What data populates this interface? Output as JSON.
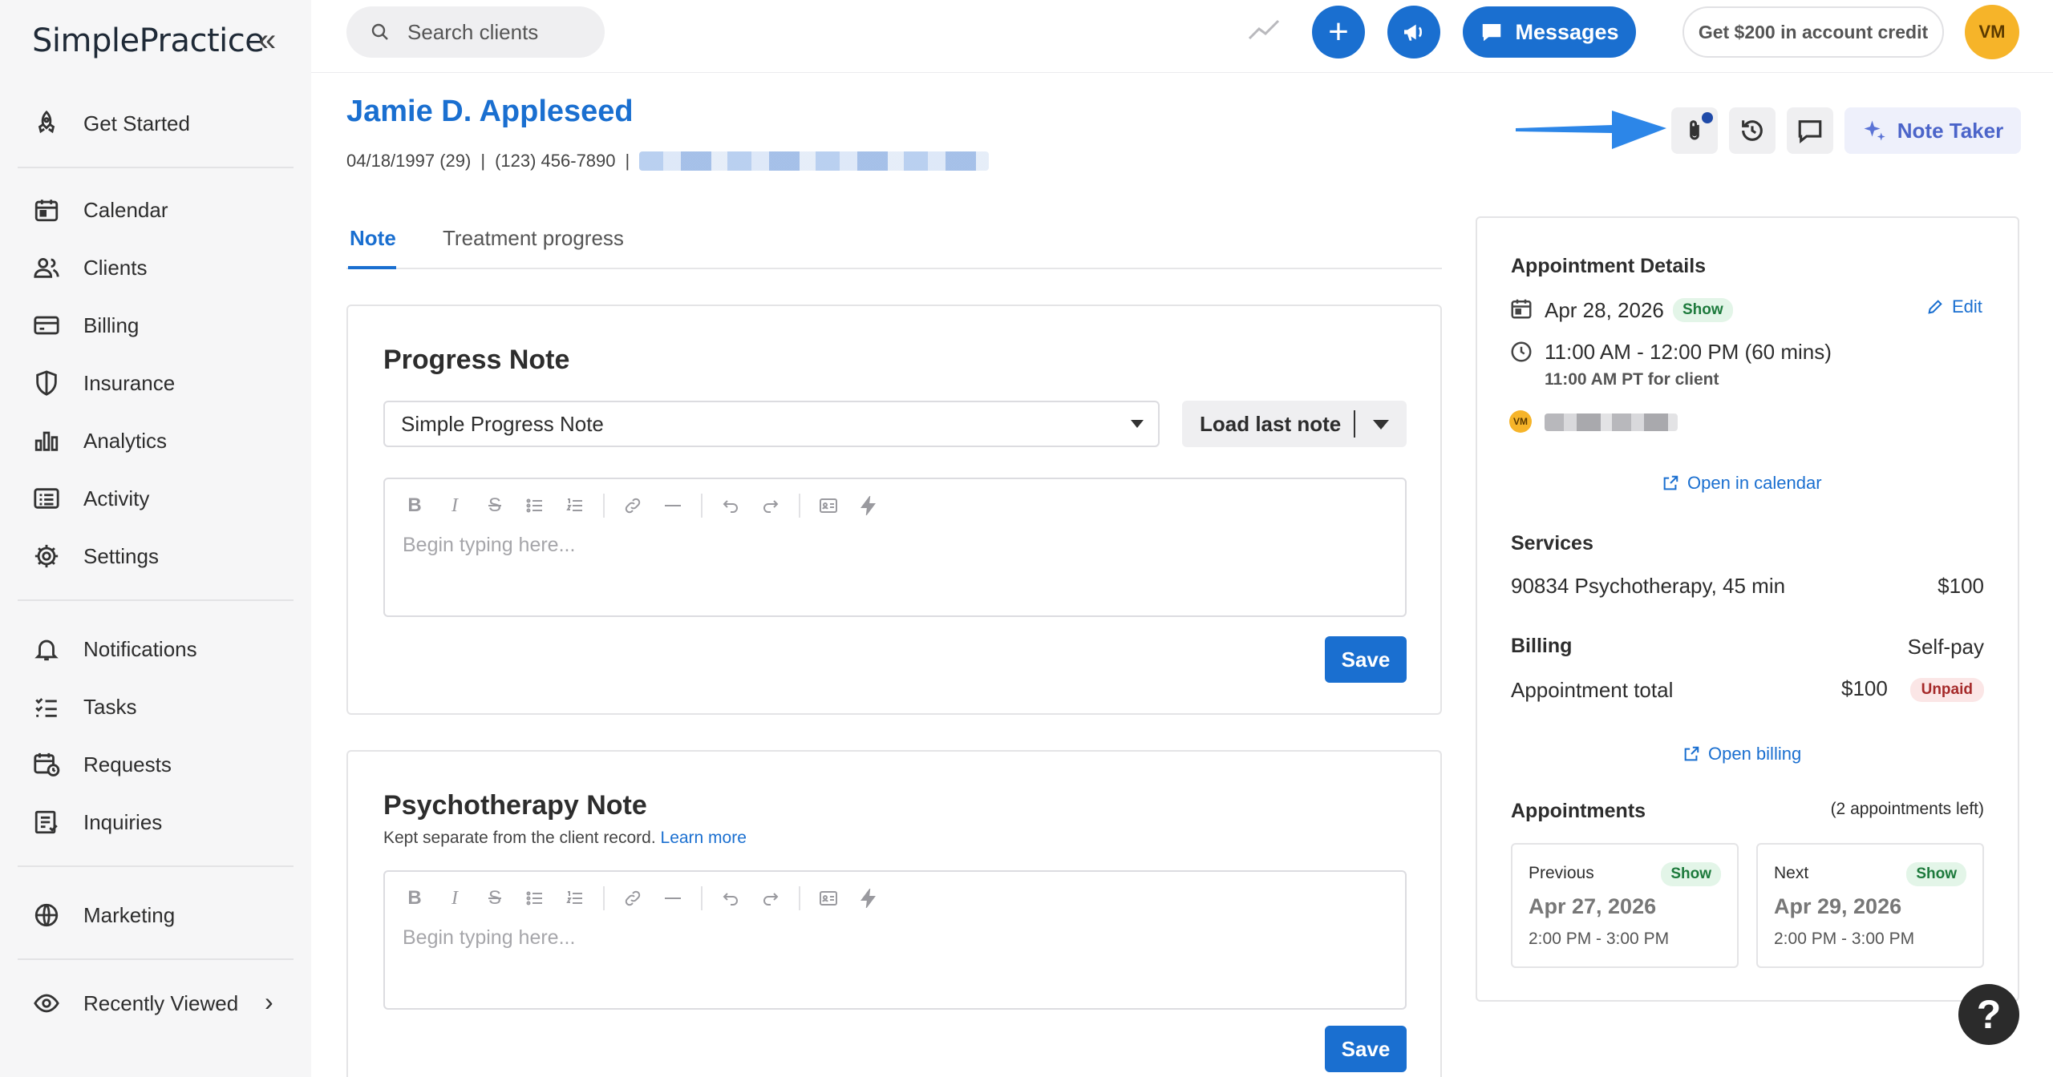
{
  "app": {
    "logo": "SimplePractice"
  },
  "sidebar": {
    "collapse_label": "«",
    "items": [
      {
        "label": "Get Started",
        "icon": "rocket-icon"
      },
      {
        "label": "Calendar",
        "icon": "calendar-icon"
      },
      {
        "label": "Clients",
        "icon": "users-icon"
      },
      {
        "label": "Billing",
        "icon": "credit-card-icon"
      },
      {
        "label": "Insurance",
        "icon": "shield-icon"
      },
      {
        "label": "Analytics",
        "icon": "bar-chart-icon"
      },
      {
        "label": "Activity",
        "icon": "list-icon"
      },
      {
        "label": "Settings",
        "icon": "gear-icon"
      },
      {
        "label": "Notifications",
        "icon": "bell-icon"
      },
      {
        "label": "Tasks",
        "icon": "checklist-icon"
      },
      {
        "label": "Requests",
        "icon": "calendar-clock-icon"
      },
      {
        "label": "Inquiries",
        "icon": "inbox-icon"
      },
      {
        "label": "Marketing",
        "icon": "globe-icon"
      },
      {
        "label": "Recently Viewed",
        "icon": "eye-icon"
      }
    ]
  },
  "topbar": {
    "search_placeholder": "Search clients",
    "messages_label": "Messages",
    "credit_label": "Get $200 in account credit",
    "avatar_initials": "VM"
  },
  "client": {
    "name": "Jamie D. Appleseed",
    "dob": "04/18/1997 (29)",
    "phone": "(123) 456-7890",
    "separator": "|"
  },
  "header_tools": {
    "note_taker_label": "Note Taker"
  },
  "tabs": [
    {
      "label": "Note",
      "active": true
    },
    {
      "label": "Treatment progress",
      "active": false
    }
  ],
  "progress_note": {
    "title": "Progress Note",
    "template_value": "Simple Progress Note",
    "load_label": "Load last note",
    "placeholder": "Begin typing here...",
    "save_label": "Save"
  },
  "psychotherapy_note": {
    "title": "Psychotherapy Note",
    "subtitle": "Kept separate from the client record.",
    "learn_more": "Learn more",
    "placeholder": "Begin typing here...",
    "save_label": "Save"
  },
  "appointment": {
    "heading": "Appointment Details",
    "date": "Apr 28, 2026",
    "status": "Show",
    "edit_label": "Edit",
    "time": "11:00 AM - 12:00 PM (60 mins)",
    "client_time": "11:00 AM PT for client",
    "clinician_initials": "VM",
    "open_calendar": "Open in calendar"
  },
  "services": {
    "heading": "Services",
    "item": "90834 Psychotherapy, 45 min",
    "price": "$100"
  },
  "billing": {
    "heading": "Billing",
    "type": "Self-pay",
    "total_label": "Appointment total",
    "total_value": "$100",
    "status": "Unpaid",
    "open_billing": "Open billing"
  },
  "appointments": {
    "heading": "Appointments",
    "remaining": "(2 appointments left)",
    "previous": {
      "label": "Previous",
      "status": "Show",
      "date": "Apr 27, 2026",
      "time": "2:00 PM - 3:00 PM"
    },
    "next": {
      "label": "Next",
      "status": "Show",
      "date": "Apr 29, 2026",
      "time": "2:00 PM - 3:00 PM"
    }
  },
  "help_label": "?",
  "colors": {
    "accent": "#1a6fd0",
    "avatar": "#f6b429",
    "note_taker": "#4b64c9"
  }
}
